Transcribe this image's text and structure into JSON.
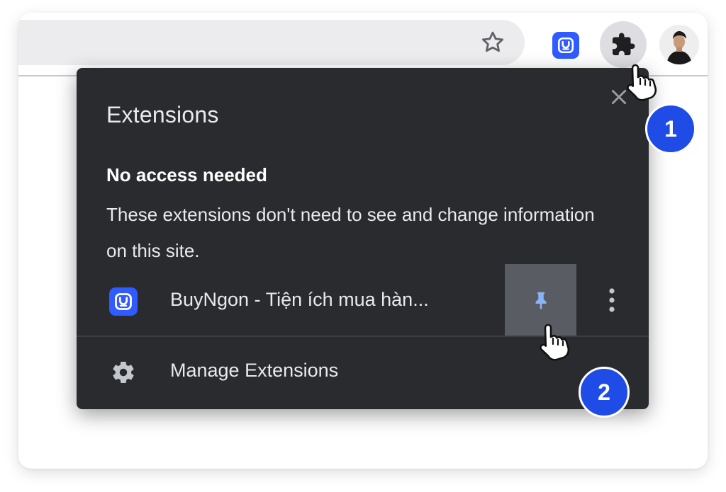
{
  "browser": {
    "star_icon": "star-outline-icon",
    "extension_icon": "buyngon-logo-icon",
    "puzzle_icon": "puzzle-piece-icon",
    "avatar_icon": "profile-avatar"
  },
  "popup": {
    "title": "Extensions",
    "close_icon": "close-icon",
    "section_heading": "No access needed",
    "section_description": "These extensions don't need to see and change information on this site.",
    "extension": {
      "name": "BuyNgon - Tiện ích mua hàn...",
      "pin_icon": "pin-icon",
      "more_icon": "more-vert-icon"
    },
    "manage": {
      "label": "Manage Extensions",
      "icon": "gear-icon"
    }
  },
  "annotations": {
    "step1": "1",
    "step2": "2"
  },
  "colors": {
    "popup_bg": "#2a2b2f",
    "accent_blue": "#2f5bff",
    "badge_blue": "#1f4be6",
    "pin_blue": "#8ab4f8"
  }
}
